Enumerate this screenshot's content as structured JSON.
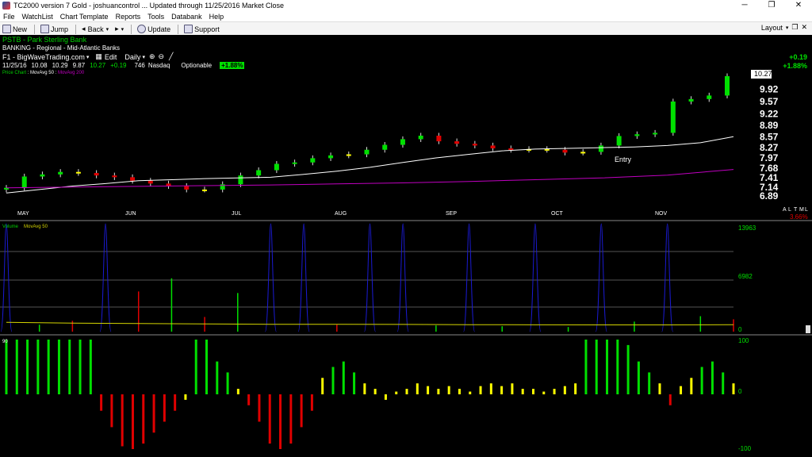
{
  "window": {
    "title": "TC2000 version 7 Gold - joshuancontrol   ... Updated through 11/25/2016  Market Close",
    "minimize": "─",
    "maximize": "❐",
    "close": "✕"
  },
  "menu": [
    "File",
    "WatchList",
    "Chart Template",
    "Reports",
    "Tools",
    "Databank",
    "Help"
  ],
  "toolbar": {
    "new_label": "New",
    "jump_label": "Jump",
    "back_label": "Back",
    "forward_label": "▸",
    "update_label": "Update",
    "support_label": "Support",
    "layout_label": "Layout",
    "icons": [
      "new-icon",
      "jump-icon",
      "back-icon",
      "forward-icon",
      "update-icon",
      "support-icon"
    ]
  },
  "symbol": {
    "ticker": "PSTB",
    "name": "Park Sterling Bank",
    "industry": "BANKING - Regional - Mid-Atlantic Banks",
    "watchlist": "F1 - BigWaveTrading.com",
    "edit_label": "Edit",
    "timeframe": "Daily",
    "date": "11/25/16",
    "open": "10.08",
    "high": "10.29",
    "low": "9.87",
    "close": "10.27",
    "change": "+0.19",
    "volume": "746",
    "exchange": "Nasdaq",
    "optionable": "Optionable",
    "pct_badge": "+1.88%",
    "right_change": "+0.19",
    "right_pct": "+1.88%"
  },
  "price_chart": {
    "label_main": "Price Chart",
    "label_ma50": "MovAvg 50",
    "label_ma200": "MovAvg 200",
    "price_axis": [
      "10.27",
      "9.92",
      "9.57",
      "9.22",
      "8.89",
      "8.57",
      "8.27",
      "7.97",
      "7.68",
      "7.41",
      "7.14",
      "6.89"
    ],
    "months": [
      "MAY",
      "JUN",
      "JUL",
      "AUG",
      "SEP",
      "OCT",
      "NOV"
    ],
    "annotation": "Entry",
    "scale_labels": [
      "A",
      "L",
      "T",
      "M",
      "L"
    ],
    "pct_label": "3.66%"
  },
  "volume_chart": {
    "label": "Volume",
    "label_ma": "MovAvg 50",
    "axis": [
      "13963",
      "6982",
      "0"
    ]
  },
  "oscillator": {
    "label": "90",
    "axis": [
      "100",
      "0",
      "-100"
    ]
  },
  "colors": {
    "up": "#00e000",
    "down": "#e00000",
    "neutral": "#ffff00",
    "ma50": "#ffffff",
    "ma200": "#c000c0",
    "volume_ma": "#d4d400",
    "blue": "#1a1ad0"
  },
  "chart_data": [
    {
      "type": "line",
      "title": "PSTB - Park Sterling Bank",
      "xlabel": "",
      "ylabel": "",
      "categories": [
        "MAY",
        "JUN",
        "JUL",
        "AUG",
        "SEP",
        "OCT",
        "NOV"
      ],
      "ylim": [
        6.89,
        10.27
      ],
      "series": [
        {
          "name": "Price Chart",
          "values": [
            7.1,
            7.42,
            7.48,
            7.55,
            7.52,
            7.45,
            7.4,
            7.3,
            7.22,
            7.15,
            7.05,
            7.05,
            7.2,
            7.45,
            7.6,
            7.78,
            7.82,
            7.94,
            8.02,
            8.05,
            8.18,
            8.32,
            8.48,
            8.58,
            8.42,
            8.35,
            8.3,
            8.22,
            8.18,
            8.2,
            8.18,
            8.1,
            8.12,
            8.3,
            8.57,
            8.62,
            8.66,
            9.55,
            9.62,
            9.72,
            10.27
          ]
        },
        {
          "name": "MovAvg 50",
          "values": [
            6.95,
            7.05,
            7.15,
            7.22,
            7.3,
            7.33,
            7.36,
            7.38,
            7.4,
            7.48,
            7.57,
            7.68,
            7.82,
            7.95,
            8.05,
            8.15,
            8.2,
            8.22,
            8.24,
            8.26,
            8.3,
            8.38,
            8.55
          ]
        },
        {
          "name": "MovAvg 200",
          "values": [
            7.1,
            7.12,
            7.14,
            7.16,
            7.18,
            7.21,
            7.24,
            7.28,
            7.33,
            7.38,
            7.46,
            7.62
          ]
        }
      ]
    },
    {
      "type": "bar",
      "title": "Volume",
      "xlabel": "",
      "ylabel": "",
      "ylim": [
        0,
        13963
      ],
      "categories": [
        "MAY",
        "JUN",
        "JUL",
        "AUG",
        "SEP",
        "OCT",
        "NOV"
      ],
      "series": [
        {
          "name": "Volume",
          "values": [
            13963,
            900,
            1400,
            13963,
            5200,
            6900,
            1900,
            5000,
            13963,
            13963,
            900,
            13963,
            13963,
            800,
            13963,
            700,
            13963,
            600,
            13963,
            1300,
            13963,
            2000,
            1600
          ]
        },
        {
          "name": "MovAvg 50",
          "values": [
            1200,
            1100,
            1050,
            1000,
            950,
            950,
            930,
            900,
            880,
            870,
            870,
            900
          ]
        }
      ]
    },
    {
      "type": "bar",
      "title": "",
      "xlabel": "",
      "ylabel": "",
      "ylim": [
        -100,
        100
      ],
      "categories": [
        "MAY",
        "JUN",
        "JUL",
        "AUG",
        "SEP",
        "OCT",
        "NOV"
      ],
      "series": [
        {
          "name": "",
          "values": [
            100,
            100,
            100,
            100,
            100,
            100,
            100,
            100,
            100,
            -30,
            -60,
            -95,
            -100,
            -90,
            -70,
            -50,
            -30,
            -10,
            100,
            100,
            60,
            40,
            10,
            -20,
            -50,
            -90,
            -100,
            -90,
            -60,
            -30,
            30,
            50,
            60,
            40,
            20,
            10,
            -10,
            5,
            10,
            20,
            15,
            10,
            15,
            10,
            5,
            15,
            20,
            15,
            20,
            10,
            10,
            5,
            10,
            15,
            20,
            100,
            100,
            100,
            100,
            90,
            60,
            40,
            20,
            -20,
            15,
            30,
            50,
            60,
            40,
            20
          ]
        }
      ]
    }
  ]
}
